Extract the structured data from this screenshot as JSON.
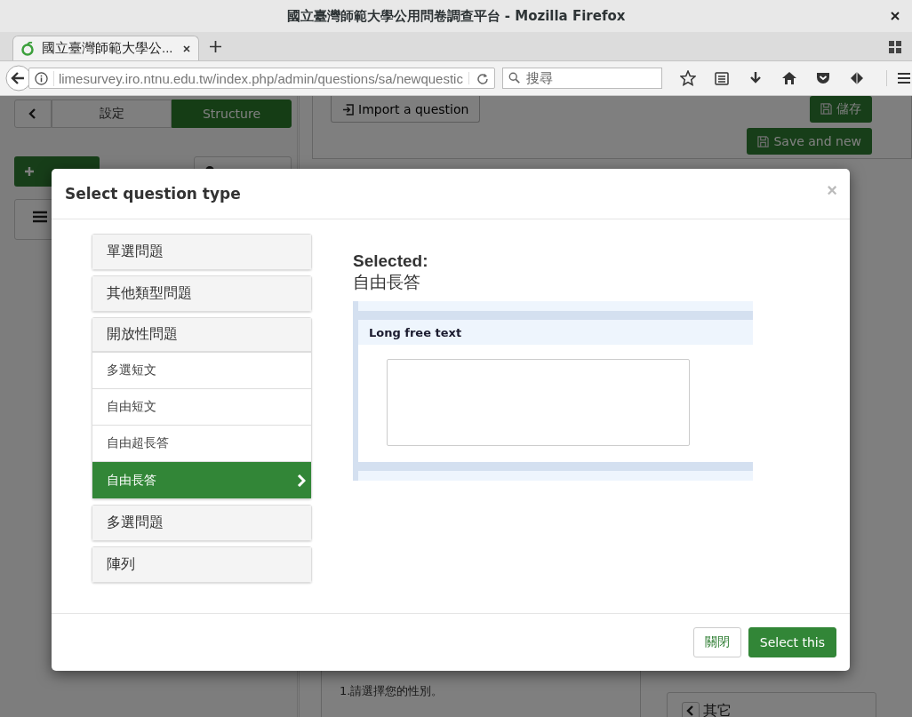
{
  "window": {
    "title": "國立臺灣師範大學公用問卷調查平台 - Mozilla Firefox"
  },
  "browser": {
    "tab_title": "國立臺灣師範大學公...",
    "url": "limesurvey.iro.ntnu.edu.tw/index.php/admin/questions/sa/newquestic",
    "search_placeholder": "搜尋"
  },
  "sidebar": {
    "tabs": [
      {
        "label": "設定",
        "selected": false
      },
      {
        "label": "Structure",
        "selected": true
      }
    ]
  },
  "toolbar": {
    "import": "Import a question",
    "save": "儲存",
    "save_new": "Save and new"
  },
  "background": {
    "question_text": "1.請選擇您的性別。",
    "side_box": "其它"
  },
  "dialog": {
    "title": "Select question type",
    "close": "×",
    "groups": [
      {
        "label": "單選問題",
        "expanded": false
      },
      {
        "label": "其他類型問題",
        "expanded": false
      },
      {
        "label": "開放性問題",
        "expanded": true,
        "items": [
          {
            "label": "多選短文",
            "selected": false
          },
          {
            "label": "自由短文",
            "selected": false
          },
          {
            "label": "自由超長答",
            "selected": false
          },
          {
            "label": "自由長答",
            "selected": true
          }
        ]
      },
      {
        "label": "多選問題",
        "expanded": false
      },
      {
        "label": "陣列",
        "expanded": false
      }
    ],
    "selected_heading": "Selected:",
    "selected_name": "自由長答",
    "preview_label": "Long free text",
    "buttons": [
      {
        "label": "關閉",
        "kind": "default"
      },
      {
        "label": "Select this",
        "kind": "primary"
      }
    ]
  }
}
